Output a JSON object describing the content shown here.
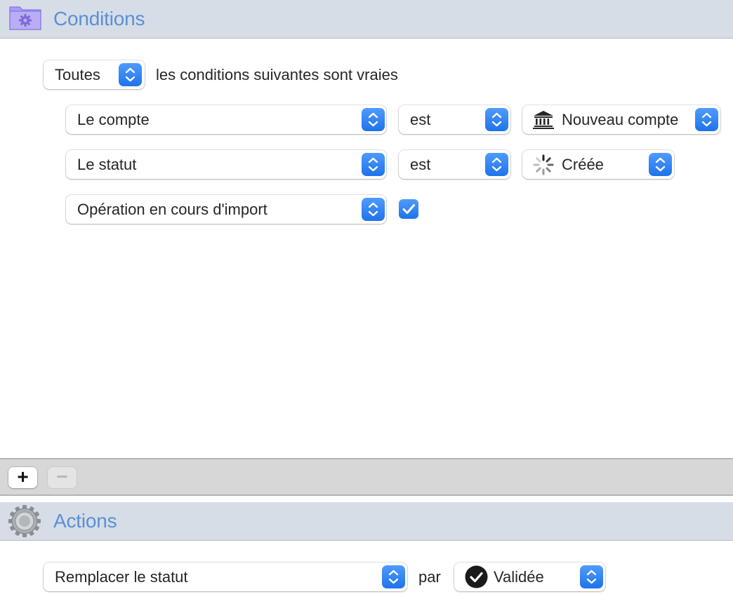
{
  "conditions": {
    "title": "Conditions",
    "icon": "folder-gear-icon",
    "match_mode": {
      "value": "Toutes",
      "suffix": "les conditions suivantes sont vraies"
    },
    "rules": [
      {
        "field": "Le compte",
        "operator": "est",
        "value": "Nouveau compte",
        "value_icon": "bank-icon"
      },
      {
        "field": "Le statut",
        "operator": "est",
        "value": "Créée",
        "value_icon": "spinner-icon"
      },
      {
        "field": "Opération en cours d'import",
        "checkbox_checked": true
      }
    ]
  },
  "button_bar": {
    "add_label": "+",
    "remove_label": "−",
    "remove_enabled": false
  },
  "actions": {
    "title": "Actions",
    "icon": "gear-icon",
    "action": {
      "field": "Remplacer le statut",
      "connector": "par",
      "value": "Validée",
      "value_icon": "checkmark-circle-icon"
    }
  },
  "colors": {
    "accent": "#2a7ff5",
    "header_title": "#5b8fd8",
    "header_bg": "#d6dde6"
  }
}
